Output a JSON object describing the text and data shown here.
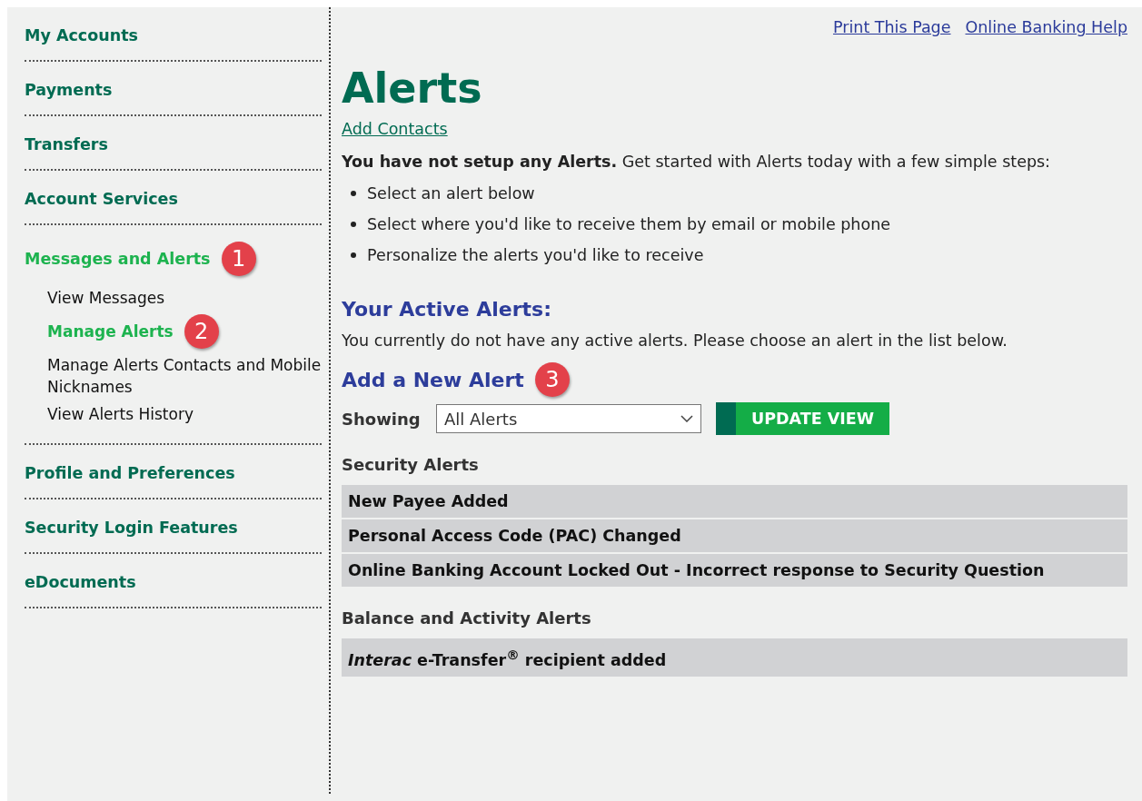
{
  "header_links": [
    "Print This Page",
    "Online Banking Help"
  ],
  "sidebar": {
    "items": [
      {
        "label": "My Accounts",
        "selected": false
      },
      {
        "label": "Payments",
        "selected": false
      },
      {
        "label": "Transfers",
        "selected": false
      },
      {
        "label": "Account Services",
        "selected": false
      },
      {
        "label": "Messages and Alerts",
        "selected": true,
        "badge": "1",
        "children": [
          {
            "label": "View Messages",
            "selected": false
          },
          {
            "label": "Manage Alerts",
            "selected": true,
            "badge": "2"
          },
          {
            "label": "Manage Alerts Contacts and Mobile Nicknames",
            "selected": false
          },
          {
            "label": "View Alerts History",
            "selected": false
          }
        ]
      },
      {
        "label": "Profile and Preferences",
        "selected": false
      },
      {
        "label": "Security Login Features",
        "selected": false
      },
      {
        "label": "eDocuments",
        "selected": false
      }
    ]
  },
  "page": {
    "title": "Alerts",
    "link": "Add Contacts",
    "intro": "**You have not setup any Alerts.** Get started with Alerts today with a few simple steps:",
    "steps": [
      "Select an alert below",
      "Select where you'd like to receive them by email or mobile phone",
      "Personalize the alerts you'd like to receive"
    ],
    "active_heading": "Your Active Alerts:",
    "active_text": "You currently do not have any active alerts. Please choose an alert in the list below.",
    "add_heading": "Add a New Alert",
    "add_badge": "3",
    "filter": {
      "label": "Showing",
      "value": "All Alerts"
    },
    "button": "UPDATE VIEW",
    "groups": [
      {
        "title": "Security Alerts",
        "alerts": [
          "New Payee Added",
          "Personal Access Code (PAC) Changed",
          "Online Banking Account Locked Out - Incorrect response to Security Question"
        ]
      },
      {
        "title": "Balance and Activity Alerts",
        "alerts": [
          "*Interac* e-Transfer$^{®}$ recipient added"
        ]
      }
    ]
  }
}
